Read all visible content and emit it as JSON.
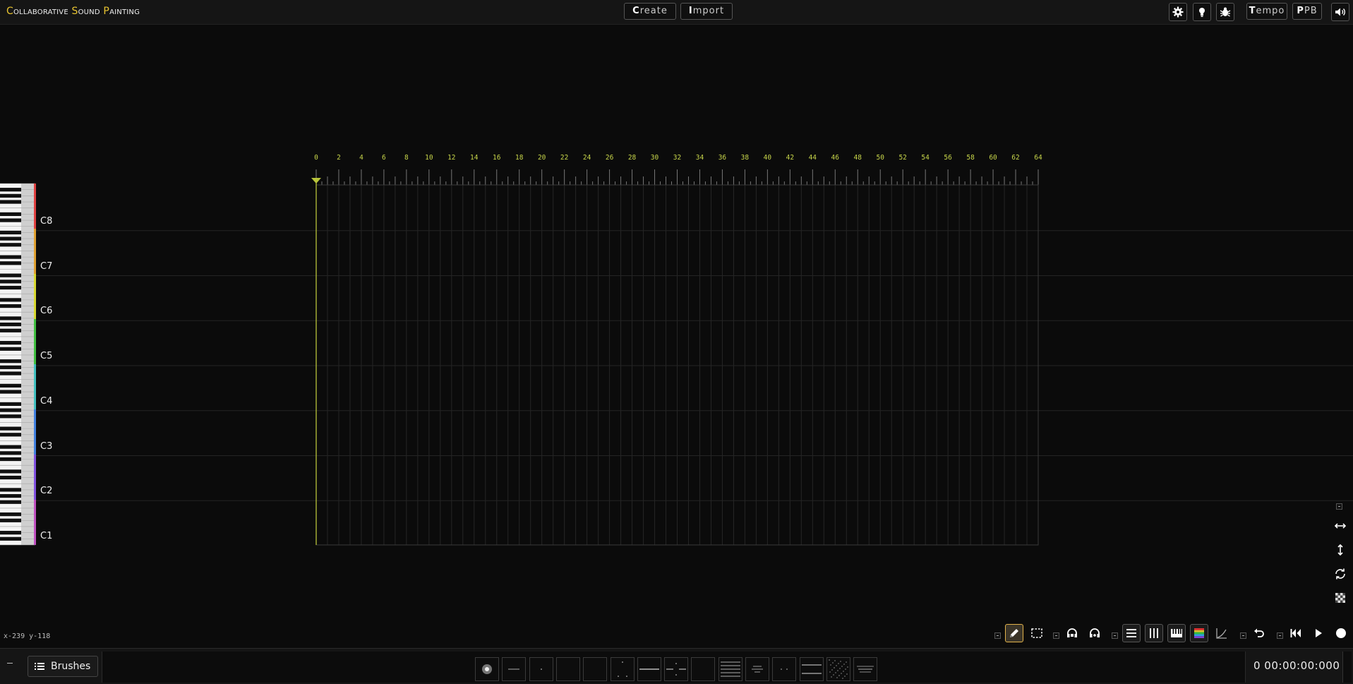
{
  "header": {
    "title_parts": [
      {
        "cap": "C",
        "rest": "ollaborative "
      },
      {
        "cap": "S",
        "rest": "ound "
      },
      {
        "cap": "P",
        "rest": "ainting"
      }
    ],
    "create_first": "C",
    "create_rest": "reate",
    "import_first": "I",
    "import_rest": "mport",
    "tempo_first": "T",
    "tempo_rest": "empo",
    "ppb_first": "P",
    "ppb_rest": "PB",
    "icons": [
      "gear-icon",
      "lightbulb-icon",
      "bug-icon",
      "volume-icon"
    ]
  },
  "ruler": {
    "labels": [
      "0",
      "2",
      "4",
      "6",
      "8",
      "10",
      "12",
      "14",
      "16",
      "18",
      "20",
      "22",
      "24",
      "26",
      "28",
      "30",
      "32",
      "34",
      "36",
      "38",
      "40",
      "42",
      "44",
      "46",
      "48",
      "50",
      "52",
      "54",
      "56",
      "58",
      "60",
      "62",
      "64"
    ]
  },
  "octaves": [
    "C8",
    "C7",
    "C6",
    "C5",
    "C4",
    "C3",
    "C2",
    "C1"
  ],
  "octave_colors": [
    "#e04040",
    "#e0a030",
    "#d8d830",
    "#40c040",
    "#40c0c0",
    "#4080e0",
    "#8050e0",
    "#c050c0"
  ],
  "status": {
    "coords": "x-239 y-118"
  },
  "side_tools": [
    "horizontal-zoom-icon",
    "vertical-zoom-icon",
    "sync-icon",
    "transparency-icon"
  ],
  "toolbar": {
    "groups": [
      [
        "pencil-icon",
        "select-icon"
      ],
      [
        "headphones-lock-icon",
        "lock-icon"
      ],
      [
        "horizontal-lines-icon",
        "vertical-lines-icon",
        "piano-icon",
        "palette-icon",
        "curve-icon"
      ],
      [
        "undo-icon"
      ],
      [
        "rewind-icon",
        "play-icon",
        "record-icon"
      ]
    ],
    "active": "pencil-icon"
  },
  "bottom": {
    "brushes_label": "Brushes",
    "time": "0 00:00:00:000",
    "brush_count": 15
  },
  "colors": {
    "accent": "#e8c430",
    "ruler": "#c8d64a",
    "active_tool": "#e1b24a"
  }
}
